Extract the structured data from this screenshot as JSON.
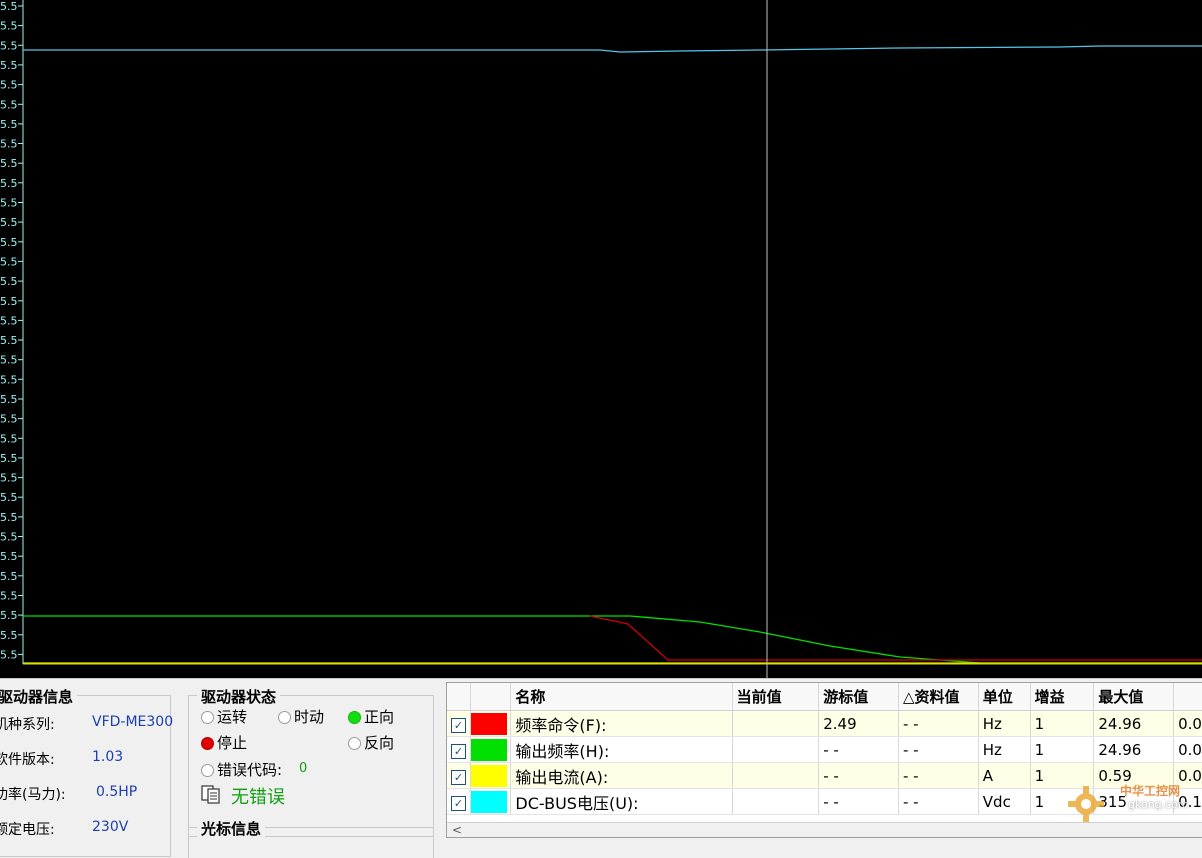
{
  "scope": {
    "y_tick_label": "5.5",
    "tick_count": 34
  },
  "drive_info": {
    "title": "驱动器信息",
    "rows": [
      {
        "label": "机种系列:",
        "value": "VFD-ME300"
      },
      {
        "label": "软件版本:",
        "value": "1.03"
      },
      {
        "label": "功率(马力):",
        "value": "0.5HP"
      },
      {
        "label": "额定电压:",
        "value": "230V"
      }
    ]
  },
  "drive_state": {
    "title": "驱动器状态",
    "run": "运转",
    "jog": "时动",
    "forward": "正向",
    "stop": "停止",
    "reverse": "反向",
    "error_code_label": "错误代码:",
    "error_code_value": "0",
    "no_error": "无错误"
  },
  "cursor_info": {
    "title": "光标信息"
  },
  "table": {
    "headers": [
      "",
      "",
      "名称",
      "当前值",
      "游标值",
      "△资料值",
      "单位",
      "增益",
      "最大值",
      ""
    ],
    "rows": [
      {
        "name": "频率命令(F):",
        "current": "",
        "cursor": "2.49",
        "delta": "- -",
        "unit": "Hz",
        "gain": "1",
        "max": "24.96",
        "extra": "0.0",
        "color": "#ff0000"
      },
      {
        "name": "输出频率(H):",
        "current": "",
        "cursor": "- -",
        "delta": "- -",
        "unit": "Hz",
        "gain": "1",
        "max": "24.96",
        "extra": "0.0",
        "color": "#00e000"
      },
      {
        "name": "输出电流(A):",
        "current": "",
        "cursor": "- -",
        "delta": "- -",
        "unit": "A",
        "gain": "1",
        "max": "0.59",
        "extra": "0.0",
        "color": "#ffff00"
      },
      {
        "name": "DC-BUS电压(U):",
        "current": "",
        "cursor": "- -",
        "delta": "- -",
        "unit": "Vdc",
        "gain": "1",
        "max": "315",
        "extra": "0.1",
        "color": "#00ffff"
      }
    ],
    "scroll_left": "<"
  },
  "watermark": {
    "text": "中华工控网",
    "url": "gkong.com"
  },
  "colors": {
    "background": "#000000",
    "tick": "#9cf3f3",
    "cyan_trace": "#4fc8e8",
    "green_trace": "#00e000",
    "red_trace": "#d00000",
    "yellow_trace": "#e0e000",
    "cursor_line": "#c0c0c0"
  }
}
